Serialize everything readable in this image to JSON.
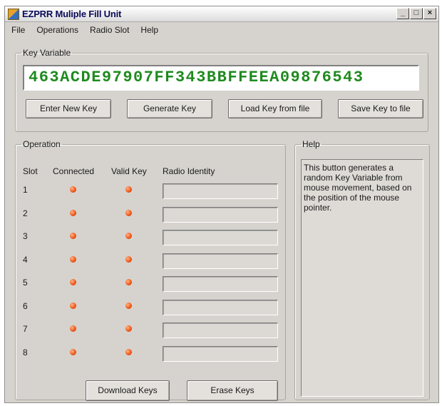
{
  "window": {
    "title": "EZPRR Muliple Fill Unit",
    "minimize": "_",
    "maximize": "□",
    "close": "×"
  },
  "menu": [
    "File",
    "Operations",
    "Radio Slot",
    "Help"
  ],
  "key_variable": {
    "legend": "Key Variable",
    "value": "463ACDE97907FF343BBFFEEA09876543",
    "buttons": {
      "enter": "Enter New Key",
      "generate": "Generate Key",
      "load": "Load Key from file",
      "save": "Save Key to file"
    }
  },
  "operation": {
    "legend": "Operation",
    "columns": {
      "slot": "Slot",
      "connected": "Connected",
      "valid": "Valid Key",
      "radio": "Radio Identity"
    },
    "slots": [
      "1",
      "2",
      "3",
      "4",
      "5",
      "6",
      "7",
      "8"
    ],
    "led_color": "#f05a1c",
    "buttons": {
      "download": "Download Keys",
      "erase": "Erase Keys"
    }
  },
  "help": {
    "legend": "Help",
    "text": "This button generates a random Key Variable from mouse movement, based on the position of the mouse pointer."
  }
}
